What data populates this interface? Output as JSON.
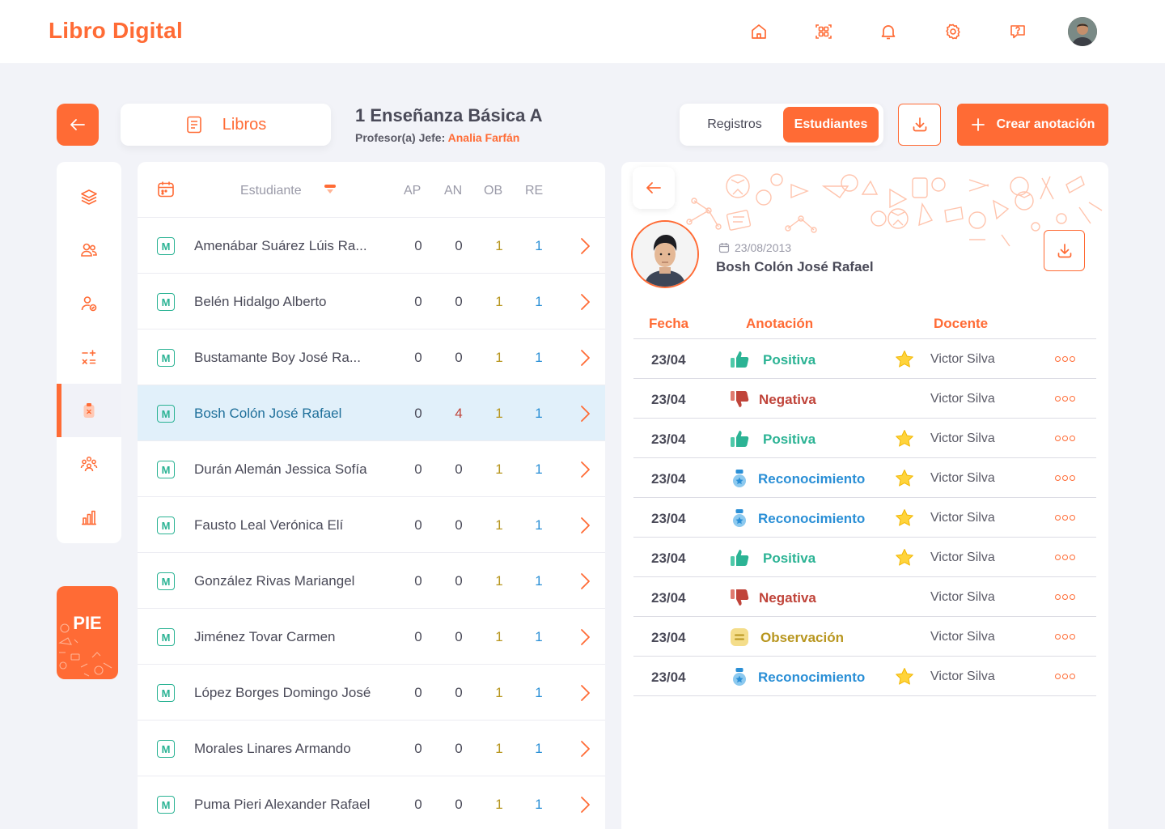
{
  "app": {
    "brand": "Libro Digital"
  },
  "colors": {
    "accent": "#ff6b35",
    "positive": "#2bb394",
    "negative": "#c0443a",
    "recognition": "#2a8fd6",
    "observation": "#b8961f"
  },
  "nav_icons": [
    "home-icon",
    "qr-scan-icon",
    "bell-icon",
    "gear-icon",
    "help-chat-icon"
  ],
  "header": {
    "libros_label": "Libros",
    "course_title": "1 Enseñanza Básica A",
    "teacher_label": "Profesor(a) Jefe:",
    "teacher_name": "Analia Farfán",
    "tabs": {
      "registros": "Registros",
      "estudiantes": "Estudiantes"
    },
    "create_label": "Crear anotación"
  },
  "sidebar": {
    "items": [
      "layers-icon",
      "users-icon",
      "user-check-icon",
      "calculator-icon",
      "clipboard-icon",
      "group-icon",
      "bar-chart-icon"
    ],
    "active_index": 4,
    "pie_label": "PIE"
  },
  "student_list": {
    "header": {
      "student": "Estudiante",
      "ap": "AP",
      "an": "AN",
      "ob": "OB",
      "re": "RE"
    },
    "selected_index": 3,
    "rows": [
      {
        "badge": "M",
        "name": "Amenábar Suárez Lúis Ra...",
        "ap": "0",
        "an": "0",
        "ob": "1",
        "re": "1"
      },
      {
        "badge": "M",
        "name": "Belén Hidalgo Alberto",
        "ap": "0",
        "an": "0",
        "ob": "1",
        "re": "1"
      },
      {
        "badge": "M",
        "name": "Bustamante Boy José Ra...",
        "ap": "0",
        "an": "0",
        "ob": "1",
        "re": "1"
      },
      {
        "badge": "M",
        "name": "Bosh Colón José Rafael",
        "ap": "0",
        "an": "4",
        "ob": "1",
        "re": "1"
      },
      {
        "badge": "M",
        "name": "Durán Alemán Jessica Sofía",
        "ap": "0",
        "an": "0",
        "ob": "1",
        "re": "1"
      },
      {
        "badge": "M",
        "name": "Fausto Leal Verónica Elí",
        "ap": "0",
        "an": "0",
        "ob": "1",
        "re": "1"
      },
      {
        "badge": "M",
        "name": "González Rivas Mariangel",
        "ap": "0",
        "an": "0",
        "ob": "1",
        "re": "1"
      },
      {
        "badge": "M",
        "name": "Jiménez Tovar Carmen",
        "ap": "0",
        "an": "0",
        "ob": "1",
        "re": "1"
      },
      {
        "badge": "M",
        "name": "López Borges Domingo José",
        "ap": "0",
        "an": "0",
        "ob": "1",
        "re": "1"
      },
      {
        "badge": "M",
        "name": "Morales Linares Armando",
        "ap": "0",
        "an": "0",
        "ob": "1",
        "re": "1"
      },
      {
        "badge": "M",
        "name": "Puma Pieri Alexander Rafael",
        "ap": "0",
        "an": "0",
        "ob": "1",
        "re": "1"
      }
    ]
  },
  "detail": {
    "birth_date": "23/08/2013",
    "student_name": "Bosh Colón José Rafael",
    "columns": {
      "date": "Fecha",
      "annotation": "Anotación",
      "teacher": "Docente"
    },
    "annotations": [
      {
        "date": "23/04",
        "type": "Positiva",
        "kind": "positive",
        "starred": true,
        "teacher": "Victor Silva"
      },
      {
        "date": "23/04",
        "type": "Negativa",
        "kind": "negative",
        "starred": false,
        "teacher": "Victor Silva"
      },
      {
        "date": "23/04",
        "type": "Positiva",
        "kind": "positive",
        "starred": true,
        "teacher": "Victor Silva"
      },
      {
        "date": "23/04",
        "type": "Reconocimiento",
        "kind": "recognition",
        "starred": true,
        "teacher": "Victor Silva"
      },
      {
        "date": "23/04",
        "type": "Reconocimiento",
        "kind": "recognition",
        "starred": true,
        "teacher": "Victor Silva"
      },
      {
        "date": "23/04",
        "type": "Positiva",
        "kind": "positive",
        "starred": true,
        "teacher": "Victor Silva"
      },
      {
        "date": "23/04",
        "type": "Negativa",
        "kind": "negative",
        "starred": false,
        "teacher": "Victor Silva"
      },
      {
        "date": "23/04",
        "type": "Observación",
        "kind": "observation",
        "starred": false,
        "teacher": "Victor Silva"
      },
      {
        "date": "23/04",
        "type": "Reconocimiento",
        "kind": "recognition",
        "starred": true,
        "teacher": "Victor Silva"
      }
    ]
  }
}
